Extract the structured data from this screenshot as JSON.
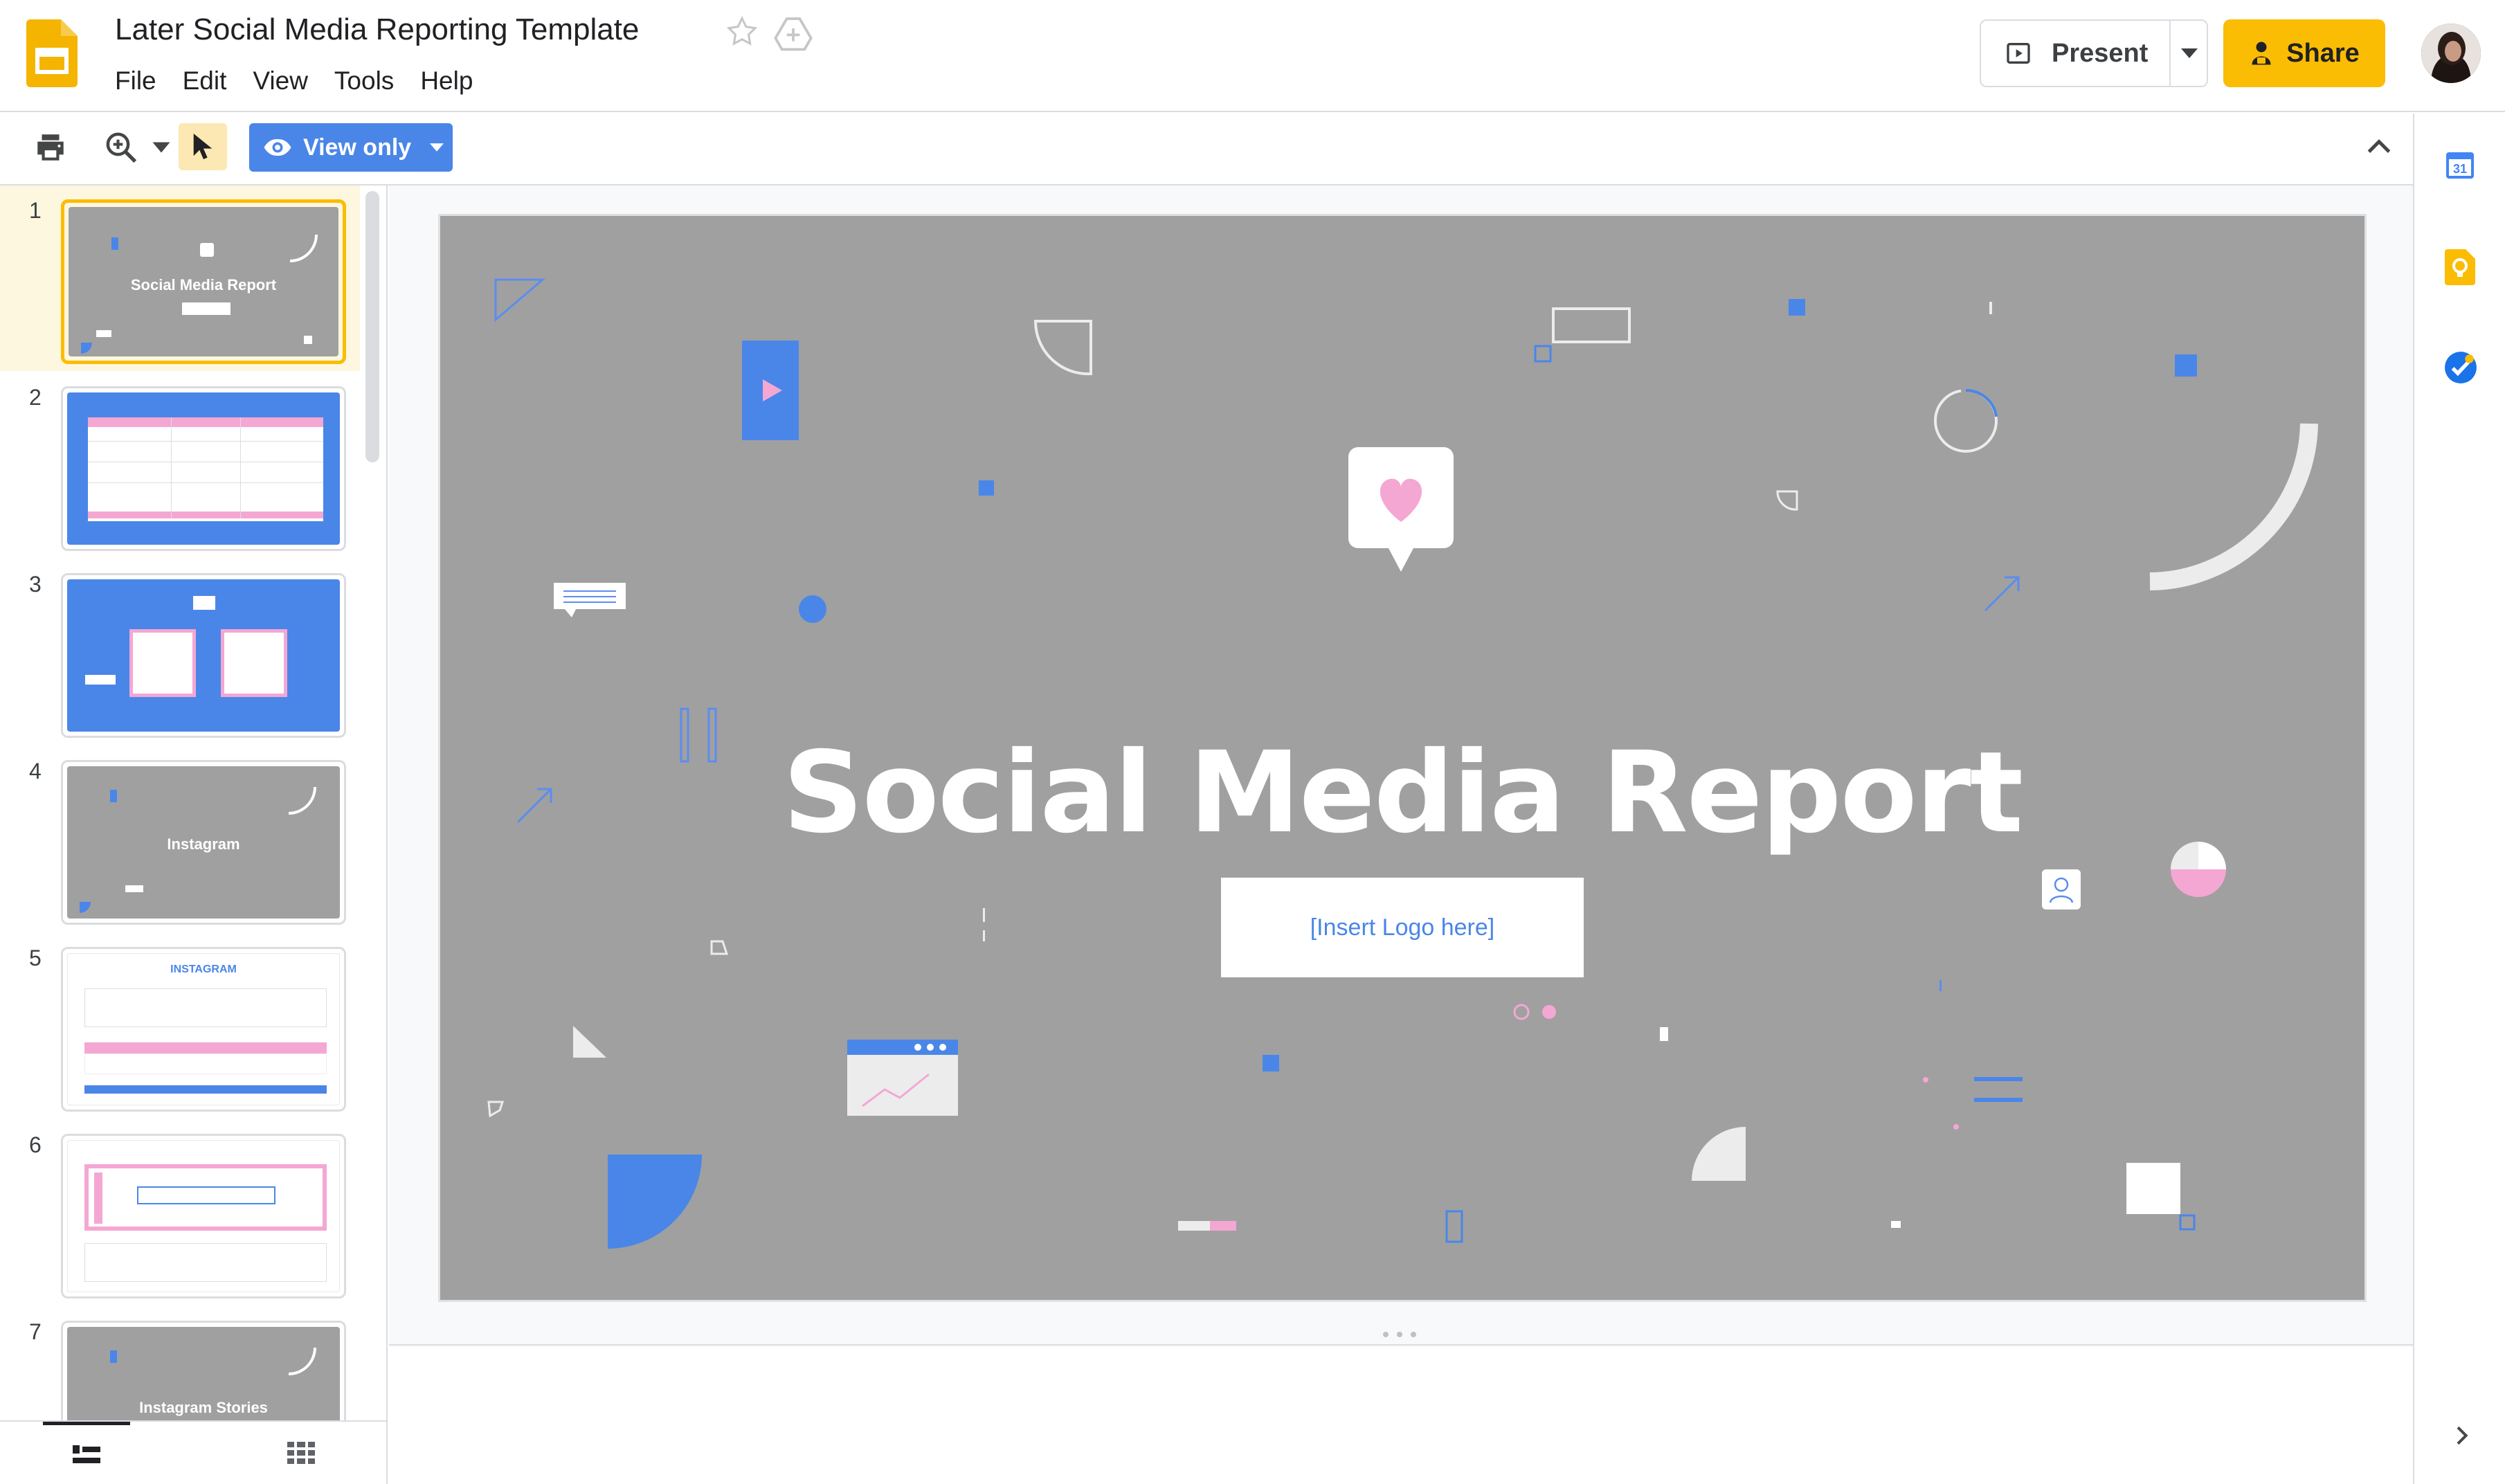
{
  "app": {
    "document_title": "Later Social Media Reporting Template",
    "menu": [
      "File",
      "Edit",
      "View",
      "Tools",
      "Help"
    ],
    "icons": {
      "app_logo": "slides-logo-icon",
      "star": "star-icon",
      "drive": "move-to-drive-icon"
    }
  },
  "header": {
    "present_label": "Present",
    "share_label": "Share",
    "share_color": "#fbbc04"
  },
  "toolbar": {
    "view_mode_label": "View only",
    "view_mode_color": "#4a86e8",
    "select_highlight": "#fce8b2"
  },
  "filmstrip": {
    "slides": [
      {
        "number": "1",
        "title": "Social Media Report",
        "theme": "gray",
        "selected": true
      },
      {
        "number": "2",
        "title": "",
        "theme": "blue",
        "selected": false
      },
      {
        "number": "3",
        "title": "",
        "theme": "blue",
        "selected": false
      },
      {
        "number": "4",
        "title": "Instagram",
        "theme": "gray",
        "selected": false
      },
      {
        "number": "5",
        "title": "INSTAGRAM",
        "theme": "white",
        "selected": false
      },
      {
        "number": "6",
        "title": "",
        "theme": "white",
        "selected": false
      },
      {
        "number": "7",
        "title": "Instagram Stories",
        "theme": "gray",
        "selected": false
      }
    ]
  },
  "slide": {
    "title": "Social Media Report",
    "logo_placeholder": "[Insert Logo here]",
    "background": "#a0a0a0",
    "accent_blue": "#4a86e8",
    "accent_pink": "#f4a7d3"
  }
}
